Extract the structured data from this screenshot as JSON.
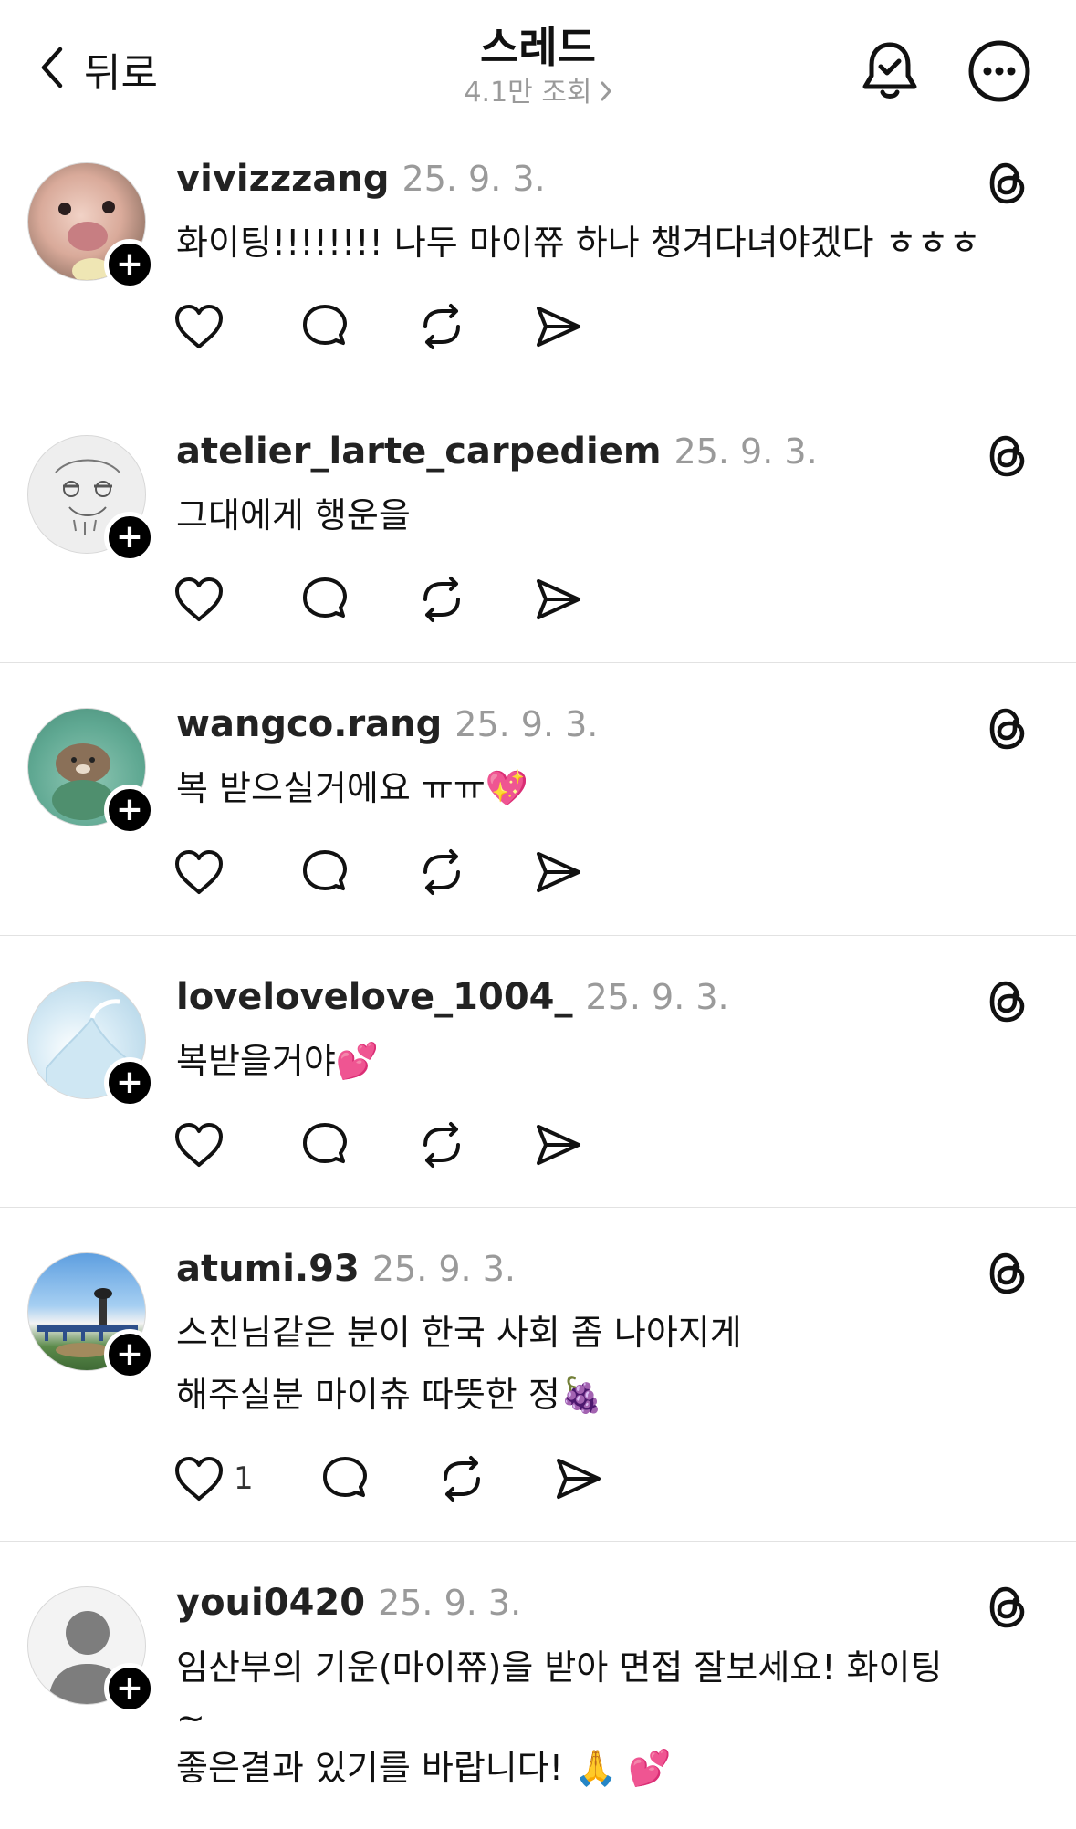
{
  "header": {
    "back_label": "뒤로",
    "title": "스레드",
    "views": "4.1만 조회"
  },
  "posts": [
    {
      "username": "vivizzzang",
      "date": "25. 9. 3.",
      "lines": [
        "화이팅!!!!!!!! 나두 마이쮸 하나 챙겨다녀야겠다 ㅎㅎㅎ"
      ],
      "like_count": "",
      "avatar": "hamster-photo"
    },
    {
      "username": "atelier_larte_carpediem",
      "date": "25. 9. 3.",
      "lines": [
        "그대에게 행운을"
      ],
      "like_count": "",
      "avatar": "sketch-face"
    },
    {
      "username": "wangco.rang",
      "date": "25. 9. 3.",
      "lines": [
        "복 받으실거에요 ㅠㅠ💖"
      ],
      "like_count": "",
      "avatar": "otter-illustration"
    },
    {
      "username": "lovelovelove_1004_",
      "date": "25. 9. 3.",
      "lines": [
        "복받을거야💕"
      ],
      "like_count": "",
      "avatar": "ice-photo"
    },
    {
      "username": "atumi.93",
      "date": "25. 9. 3.",
      "lines": [
        "스친님같은 분이 한국 사회 좀 나아지게",
        "해주실분 마이츄 따뜻한 정🍇"
      ],
      "like_count": "1",
      "avatar": "sky-landscape"
    },
    {
      "username": "youi0420",
      "date": "25. 9. 3.",
      "lines": [
        "임산부의 기운(마이쮸)을 받아 면접 잘보세요!  화이팅",
        "~",
        "좋은결과 있기를  바랍니다! 🙏 💕"
      ],
      "like_count": "",
      "avatar": "default-person"
    }
  ],
  "colors": {
    "text": "#111111",
    "muted": "#9a9a9a",
    "divider": "#e2e2e2",
    "plus_badge": "#000000"
  }
}
